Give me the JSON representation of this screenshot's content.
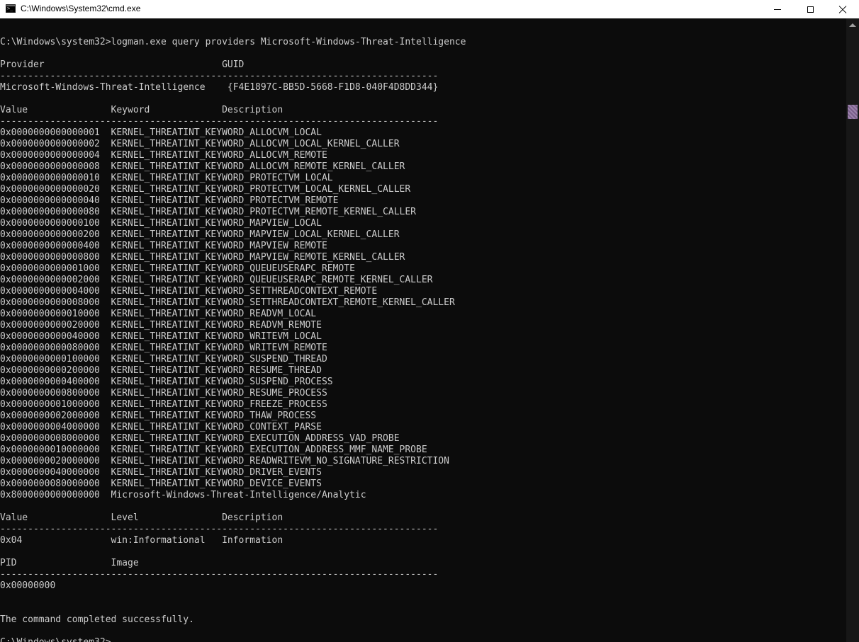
{
  "window": {
    "title": "C:\\Windows\\System32\\cmd.exe"
  },
  "console": {
    "lines": [
      "",
      "C:\\Windows\\system32>logman.exe query providers Microsoft-Windows-Threat-Intelligence",
      "",
      "Provider                                GUID",
      "-------------------------------------------------------------------------------",
      "Microsoft-Windows-Threat-Intelligence    {F4E1897C-BB5D-5668-F1D8-040F4D8DD344}",
      "",
      "Value               Keyword             Description",
      "-------------------------------------------------------------------------------",
      "0x0000000000000001  KERNEL_THREATINT_KEYWORD_ALLOCVM_LOCAL",
      "0x0000000000000002  KERNEL_THREATINT_KEYWORD_ALLOCVM_LOCAL_KERNEL_CALLER",
      "0x0000000000000004  KERNEL_THREATINT_KEYWORD_ALLOCVM_REMOTE",
      "0x0000000000000008  KERNEL_THREATINT_KEYWORD_ALLOCVM_REMOTE_KERNEL_CALLER",
      "0x0000000000000010  KERNEL_THREATINT_KEYWORD_PROTECTVM_LOCAL",
      "0x0000000000000020  KERNEL_THREATINT_KEYWORD_PROTECTVM_LOCAL_KERNEL_CALLER",
      "0x0000000000000040  KERNEL_THREATINT_KEYWORD_PROTECTVM_REMOTE",
      "0x0000000000000080  KERNEL_THREATINT_KEYWORD_PROTECTVM_REMOTE_KERNEL_CALLER",
      "0x0000000000000100  KERNEL_THREATINT_KEYWORD_MAPVIEW_LOCAL",
      "0x0000000000000200  KERNEL_THREATINT_KEYWORD_MAPVIEW_LOCAL_KERNEL_CALLER",
      "0x0000000000000400  KERNEL_THREATINT_KEYWORD_MAPVIEW_REMOTE",
      "0x0000000000000800  KERNEL_THREATINT_KEYWORD_MAPVIEW_REMOTE_KERNEL_CALLER",
      "0x0000000000001000  KERNEL_THREATINT_KEYWORD_QUEUEUSERAPC_REMOTE",
      "0x0000000000002000  KERNEL_THREATINT_KEYWORD_QUEUEUSERAPC_REMOTE_KERNEL_CALLER",
      "0x0000000000004000  KERNEL_THREATINT_KEYWORD_SETTHREADCONTEXT_REMOTE",
      "0x0000000000008000  KERNEL_THREATINT_KEYWORD_SETTHREADCONTEXT_REMOTE_KERNEL_CALLER",
      "0x0000000000010000  KERNEL_THREATINT_KEYWORD_READVM_LOCAL",
      "0x0000000000020000  KERNEL_THREATINT_KEYWORD_READVM_REMOTE",
      "0x0000000000040000  KERNEL_THREATINT_KEYWORD_WRITEVM_LOCAL",
      "0x0000000000080000  KERNEL_THREATINT_KEYWORD_WRITEVM_REMOTE",
      "0x0000000000100000  KERNEL_THREATINT_KEYWORD_SUSPEND_THREAD",
      "0x0000000000200000  KERNEL_THREATINT_KEYWORD_RESUME_THREAD",
      "0x0000000000400000  KERNEL_THREATINT_KEYWORD_SUSPEND_PROCESS",
      "0x0000000000800000  KERNEL_THREATINT_KEYWORD_RESUME_PROCESS",
      "0x0000000001000000  KERNEL_THREATINT_KEYWORD_FREEZE_PROCESS",
      "0x0000000002000000  KERNEL_THREATINT_KEYWORD_THAW_PROCESS",
      "0x0000000004000000  KERNEL_THREATINT_KEYWORD_CONTEXT_PARSE",
      "0x0000000008000000  KERNEL_THREATINT_KEYWORD_EXECUTION_ADDRESS_VAD_PROBE",
      "0x0000000010000000  KERNEL_THREATINT_KEYWORD_EXECUTION_ADDRESS_MMF_NAME_PROBE",
      "0x0000000020000000  KERNEL_THREATINT_KEYWORD_READWRITEVM_NO_SIGNATURE_RESTRICTION",
      "0x0000000040000000  KERNEL_THREATINT_KEYWORD_DRIVER_EVENTS",
      "0x0000000080000000  KERNEL_THREATINT_KEYWORD_DEVICE_EVENTS",
      "0x8000000000000000  Microsoft-Windows-Threat-Intelligence/Analytic",
      "",
      "Value               Level               Description",
      "-------------------------------------------------------------------------------",
      "0x04                win:Informational   Information",
      "",
      "PID                 Image",
      "-------------------------------------------------------------------------------",
      "0x00000000",
      "",
      "",
      "The command completed successfully.",
      ""
    ],
    "prompt": "C:\\Windows\\system32>"
  }
}
